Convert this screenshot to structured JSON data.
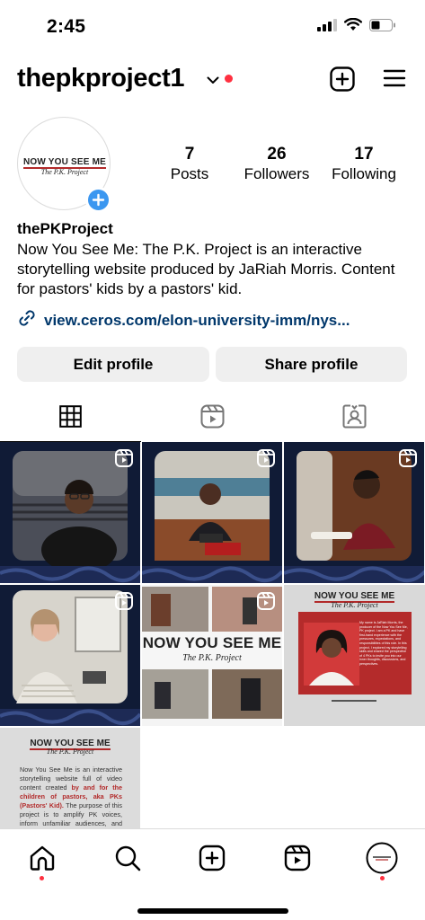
{
  "status_bar": {
    "time": "2:45",
    "icons": [
      "cellular-signal-icon",
      "wifi-icon",
      "battery-icon"
    ]
  },
  "header": {
    "username": "thepkproject1",
    "icons": [
      "chevron-down-icon",
      "plus-square-icon",
      "hamburger-menu-icon"
    ],
    "notification_dot_color": "#ff3040"
  },
  "profile": {
    "avatar_title": "NOW YOU SEE ME",
    "avatar_subtitle": "The P.K. Project",
    "stats": [
      {
        "value": "7",
        "label": "Posts"
      },
      {
        "value": "26",
        "label": "Followers"
      },
      {
        "value": "17",
        "label": "Following"
      }
    ],
    "display_name": "thePKProject",
    "bio": "Now You See Me: The P.K. Project is an interactive storytelling website produced by JaRiah Morris. Content for pastors' kids by a pastors' kid.",
    "link": "view.ceros.com/elon-university-imm/nys..."
  },
  "actions": {
    "edit_profile": "Edit profile",
    "share_profile": "Share profile"
  },
  "tabs": [
    "grid-icon",
    "reels-icon",
    "tagged-icon"
  ],
  "grid": {
    "posts": [
      {
        "kind": "reel",
        "scene": "woman-glasses-smiling"
      },
      {
        "kind": "reel",
        "scene": "man-at-pulpit"
      },
      {
        "kind": "reel",
        "scene": "young-man-seated"
      },
      {
        "kind": "reel",
        "scene": "woman-laughing"
      },
      {
        "kind": "reel",
        "scene": "collage-title",
        "title": "NOW YOU SEE ME",
        "subtitle": "The P.K. Project"
      },
      {
        "kind": "image",
        "scene": "about-producer",
        "title": "NOW YOU SEE ME",
        "subtitle": "The P.K. Project",
        "body": "My name is JaRiah Morris, the producer of the Now You See Me, PK project. I am a PK and have first-hand experience with the pressures, expectations, and responsibilities of this role. In this project, I explored my storytelling skills and shared the perspective of 4 PKs to invite you into our inner thoughts, discussions, and perspectives."
      },
      {
        "kind": "image",
        "scene": "about-project",
        "title": "NOW YOU SEE ME",
        "subtitle": "The P.K. Project",
        "body_start": "Now You See Me is an interactive storytelling website full of video content created ",
        "body_highlight": "by and for the children of pastors, aka PKs (Pastors' Kid).",
        "body_end": " The purpose of this project is to amplify PK voices, inform unfamiliar audiences, and combat"
      }
    ]
  },
  "bottom_nav": [
    "home-icon",
    "search-icon",
    "create-icon",
    "reels-icon",
    "profile-avatar"
  ],
  "colors": {
    "accent_blue": "#3b97f0",
    "link": "#00376b",
    "button_bg": "#efefef",
    "brand_red": "#b22a2a"
  }
}
